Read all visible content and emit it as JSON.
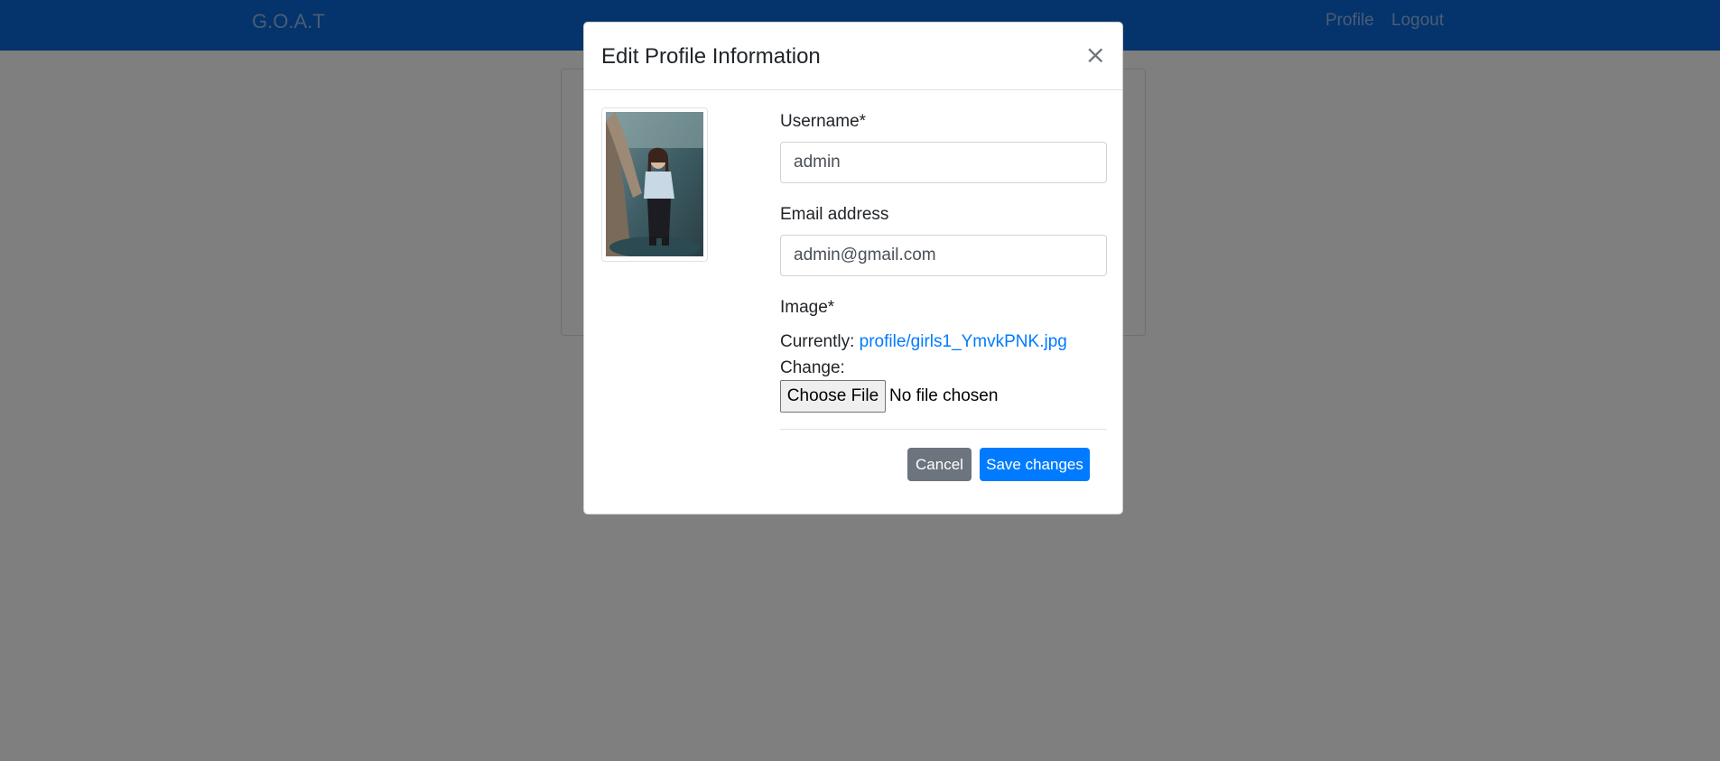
{
  "navbar": {
    "brand": "G.O.A.T",
    "links": [
      {
        "label": "Profile"
      },
      {
        "label": "Logout"
      }
    ],
    "color": "#0a67d6"
  },
  "modal": {
    "title": "Edit Profile Information",
    "close_symbol": "×",
    "avatar_icon": "profile-photo",
    "username_label": "Username*",
    "username_value": "admin",
    "email_label": "Email address",
    "email_value": "admin@gmail.com",
    "image_label": "Image*",
    "currently_label": "Currently:",
    "currently_file": "profile/girls1_YmvkPNK.jpg",
    "change_label": "Change:",
    "choose_file_label": "Choose File",
    "file_status": "No file chosen",
    "cancel_label": "Cancel",
    "save_label": "Save changes",
    "colors": {
      "primary": "#007bff",
      "secondary": "#6c757d"
    }
  }
}
